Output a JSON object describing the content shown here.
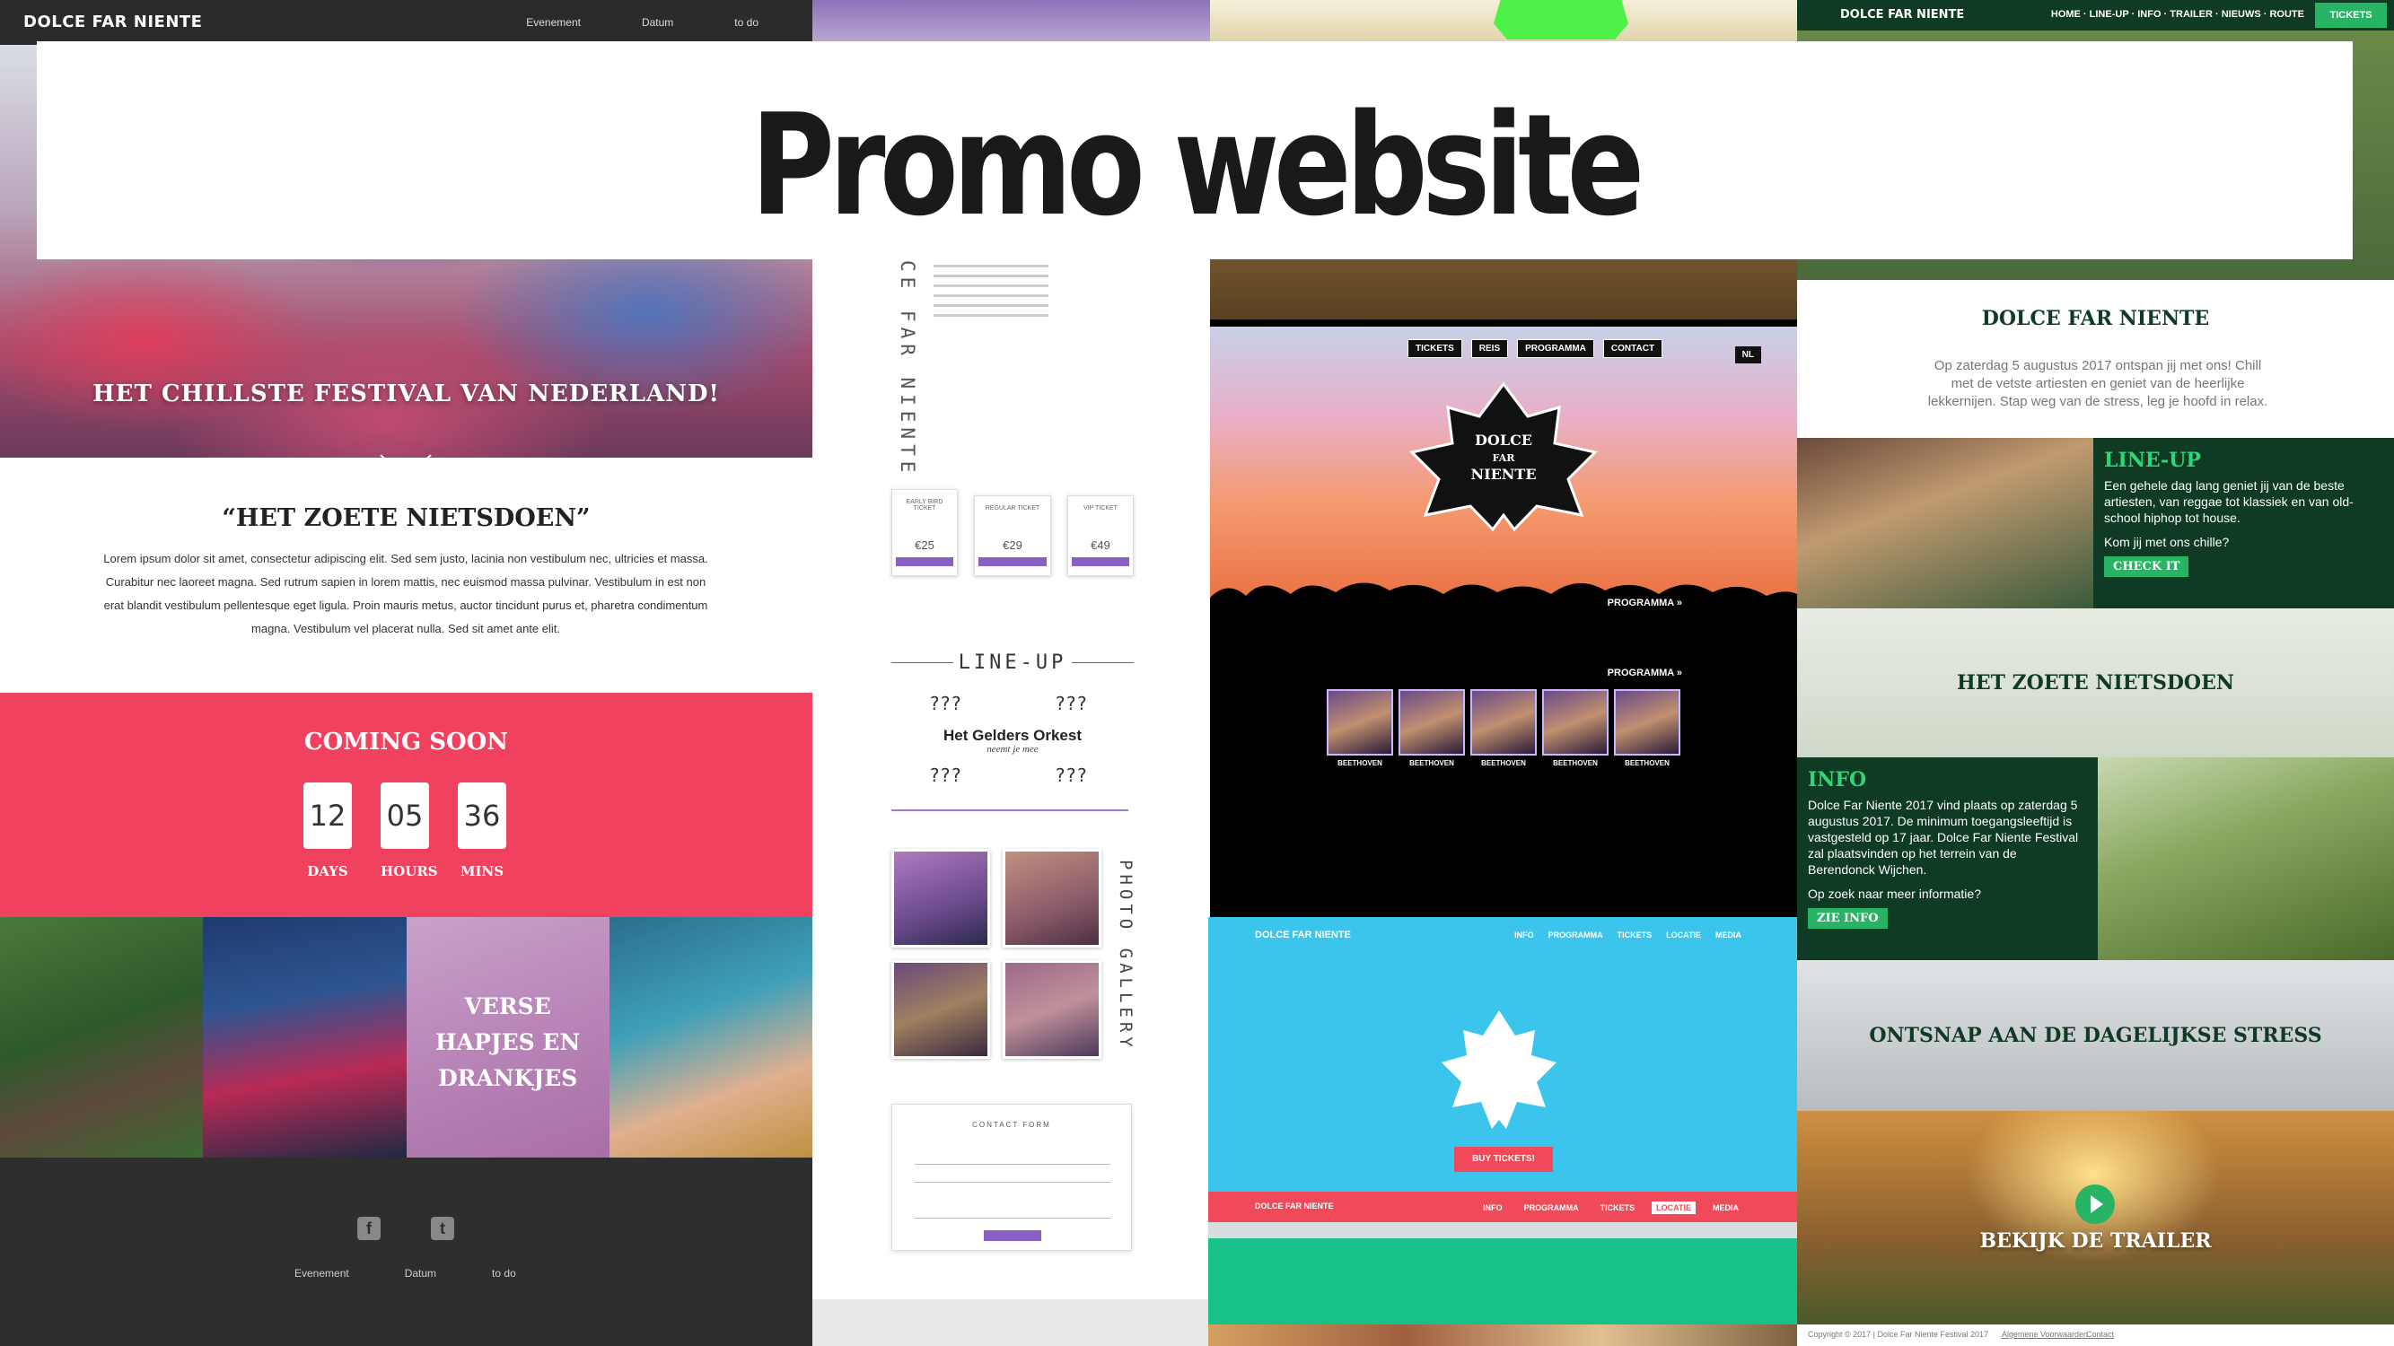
{
  "banner": {
    "title": "Promo website"
  },
  "site1": {
    "logo": "DOLCE FAR NIENTE",
    "nav": [
      "Evenement",
      "Datum",
      "to do"
    ],
    "hero_text": "HET CHILLSTE FESTIVAL VAN NEDERLAND!",
    "about_title": "“HET ZOETE NIETSDOEN”",
    "about_text": "Lorem ipsum dolor sit amet, consectetur adipiscing elit. Sed sem justo, lacinia non vestibulum nec, ultricies et massa. Curabitur nec laoreet magna. Sed rutrum sapien in lorem mattis, nec euismod massa pulvinar. Vestibulum in est non erat blandit vestibulum pellentesque eget ligula. Proin mauris metus, auctor tincidunt purus et, pharetra condimentum magna. Vestibulum vel placerat nulla. Sed sit amet ante elit.",
    "countdown_title": "COMING SOON",
    "countdown": [
      {
        "value": "12",
        "unit": "DAYS"
      },
      {
        "value": "05",
        "unit": "HOURS"
      },
      {
        "value": "36",
        "unit": "MINS"
      }
    ],
    "photo_text_lines": [
      "VERSE",
      "HAPJES EN",
      "DRANKJES"
    ],
    "footer_links": [
      "Evenement",
      "Datum",
      "to do"
    ],
    "colors": {
      "accent": "#f0415f",
      "dark": "#2b2b2b"
    }
  },
  "site2": {
    "vertical_title": "CE FAR NIENTE",
    "tickets": [
      {
        "name": "EARLY BIRD TICKET",
        "price": "€25"
      },
      {
        "name": "REGULAR TICKET",
        "price": "€29"
      },
      {
        "name": "VIP TICKET",
        "price": "€49"
      }
    ],
    "lineup_title": "LINE-UP",
    "lineup_placeholders": [
      "???",
      "???",
      "???",
      "???"
    ],
    "headliner": "Het Gelders Orkest",
    "headliner_sub": "neemt je mee",
    "gallery_title": "PHOTO GALLERY",
    "contact_title": "CONTACT FORM",
    "accent": "#8a5fc4"
  },
  "site3": {
    "nav": [
      "TICKETS",
      "REIS",
      "PROGRAMMA",
      "CONTACT"
    ],
    "lang": "NL",
    "leaf_text": [
      "DOLCE",
      "FAR",
      "NIENTE"
    ],
    "program_label": "PROGRAMMA »",
    "cards": [
      "BEETHOVEN",
      "BEETHOVEN",
      "BEETHOVEN",
      "BEETHOVEN",
      "BEETHOVEN"
    ],
    "blue_logo": "DOLCE FAR NIENTE",
    "blue_nav": [
      "INFO",
      "PROGRAMMA",
      "TICKETS",
      "LOCATIE",
      "MEDIA"
    ],
    "buy_button": "BUY TICKETS!",
    "active_nav": "LOCATIE",
    "colors": {
      "blue": "#3bc4ec",
      "red": "#f04a5a",
      "green": "#18c08a"
    }
  },
  "site4": {
    "logo": "DOLCE FAR NIENTE",
    "nav": "HOME · LINE-UP · INFO · TRAILER · NIEUWS · ROUTE",
    "tickets": "TICKETS",
    "intro_title": "DOLCE FAR NIENTE",
    "intro_text": "Op zaterdag 5 augustus 2017 ontspan jij met ons! Chill met de vetste artiesten en geniet van de heerlijke lekkernijen. Stap weg van de stress, leg je hoofd in relax.",
    "lineup": {
      "title": "LINE-UP",
      "text": "Een gehele dag lang geniet jij van de beste artiesten, van reggae tot klassiek en van old-school hiphop tot house.",
      "question": "Kom jij met ons chille?",
      "button": "CHECK IT"
    },
    "band1": "HET ZOETE NIETSDOEN",
    "info": {
      "title": "INFO",
      "text": "Dolce Far Niente 2017 vind plaats op zaterdag 5 augustus 2017. De minimum toegangsleeftijd is vastgesteld op 17 jaar. Dolce Far Niente Festival zal plaatsvinden op het terrein van de Berendonck Wijchen.",
      "question": "Op zoek naar meer informatie?",
      "button": "ZIE INFO"
    },
    "band2": "ONTSNAP AAN DE DAGELIJKSE STRESS",
    "trailer": "BEKIJK DE TRAILER",
    "footer": [
      "Copyright © 2017 | Dolce Far Niente Festival 2017",
      "Algemene Voorwaarden",
      "Contact"
    ],
    "colors": {
      "dark_green": "#0f3a24",
      "green": "#27b465"
    }
  }
}
